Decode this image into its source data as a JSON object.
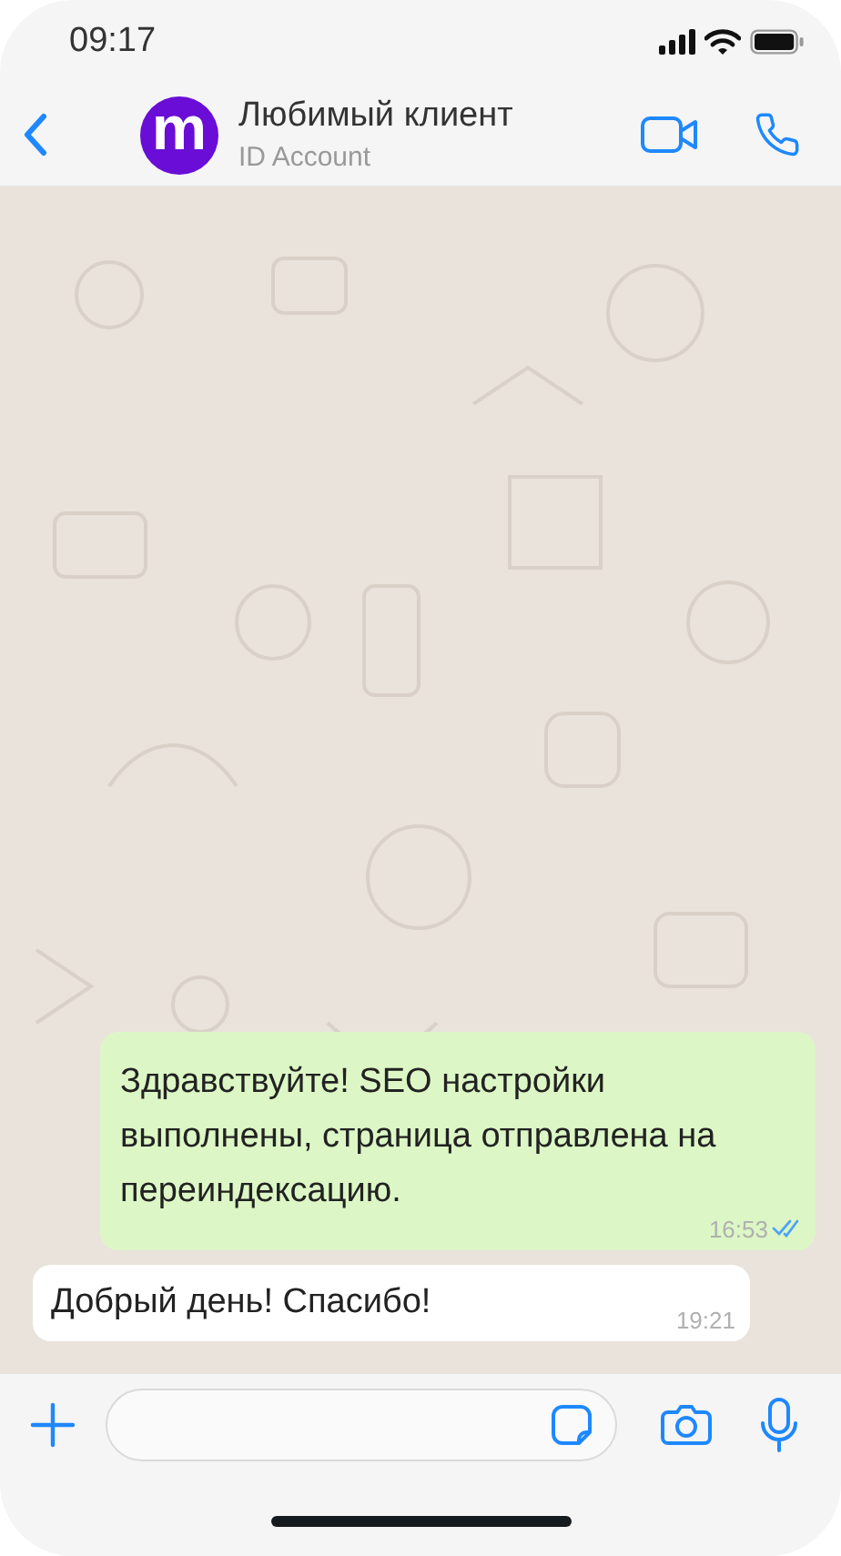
{
  "status_bar": {
    "time": "09:17"
  },
  "header": {
    "contact_name": "Любимый клиент",
    "subtitle": "ID Account",
    "avatar_letter": "m"
  },
  "messages": [
    {
      "kind": "outgoing",
      "text": "Здравствуйте! SEO настройки выполнены, страница отправлена на переиндексацию.",
      "time": "16:53",
      "read": true
    },
    {
      "kind": "incoming",
      "text": "Добрый день! Спасибо!",
      "time": "19:21"
    }
  ]
}
